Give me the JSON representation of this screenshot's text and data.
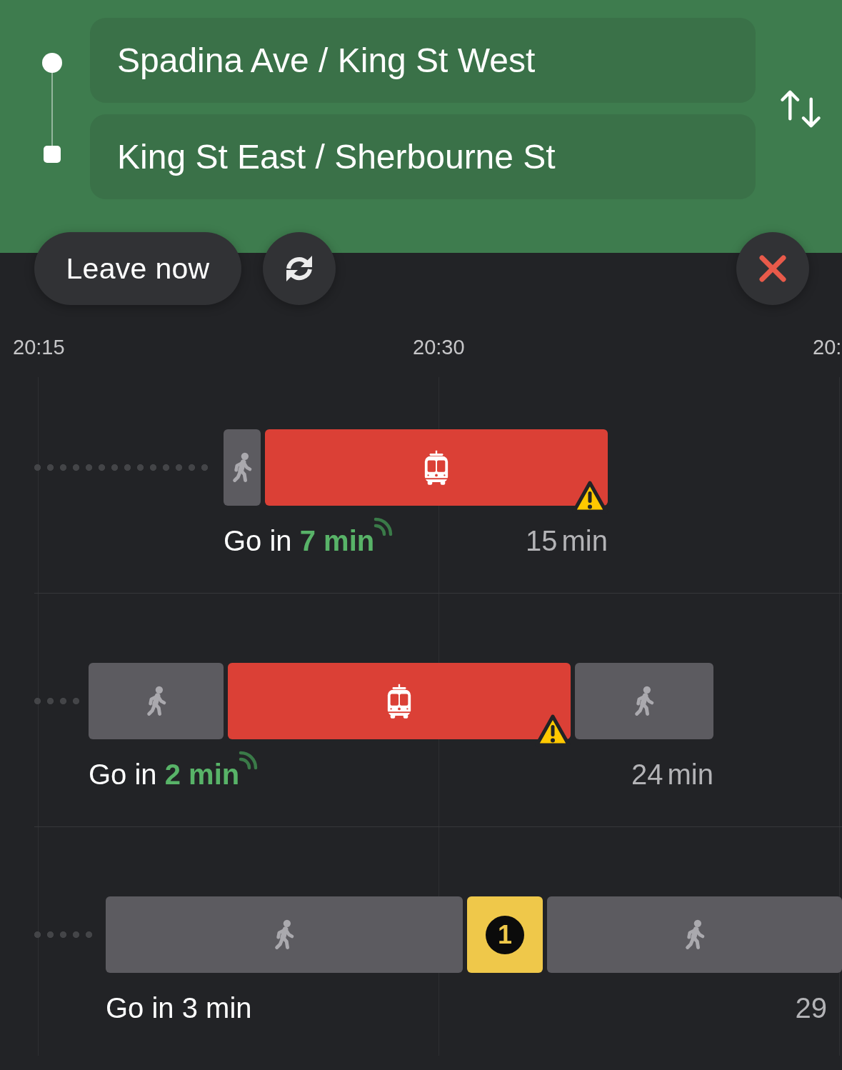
{
  "route": {
    "origin": "Spadina Ave / King St West",
    "destination": "King St East / Sherbourne St"
  },
  "actions": {
    "leave_time": "Leave now"
  },
  "timeline": {
    "ticks": [
      "20:15",
      "20:30",
      "20:"
    ]
  },
  "trips": [
    {
      "legs": [
        {
          "kind": "walk",
          "alert": false
        },
        {
          "kind": "tram",
          "alert": true
        }
      ],
      "departure": {
        "prefix": "Go in",
        "time": "7 min",
        "realtime": true
      },
      "duration": "15 min"
    },
    {
      "legs": [
        {
          "kind": "walk",
          "alert": false
        },
        {
          "kind": "tram",
          "alert": true
        },
        {
          "kind": "walk",
          "alert": false
        }
      ],
      "departure": {
        "prefix": "Go in",
        "time": "2 min",
        "realtime": true
      },
      "duration": "24 min"
    },
    {
      "legs": [
        {
          "kind": "walk",
          "alert": false
        },
        {
          "kind": "route",
          "label": "1",
          "alert": false
        },
        {
          "kind": "walk",
          "alert": false
        }
      ],
      "departure": {
        "prefix": "Go in",
        "time": "3 min",
        "realtime": false
      },
      "duration": "29"
    }
  ]
}
